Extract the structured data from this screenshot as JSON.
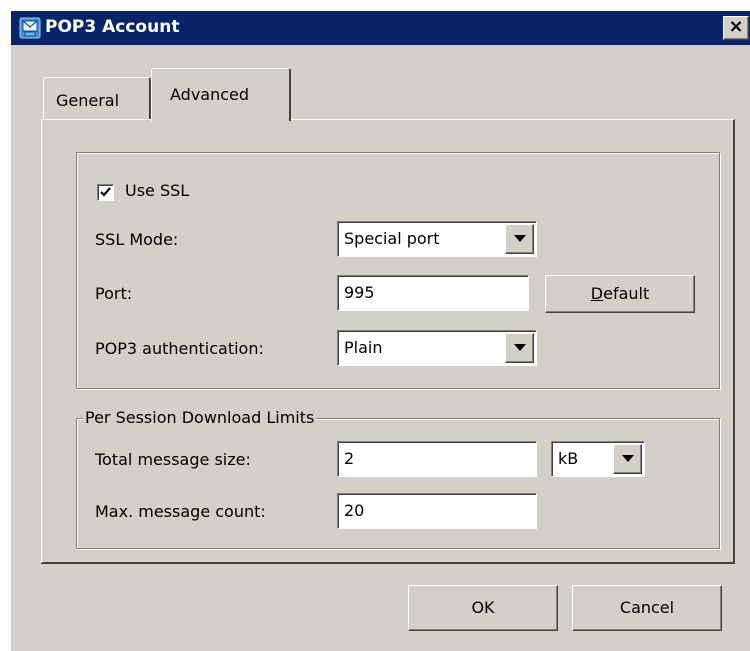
{
  "window": {
    "title": "POP3 Account",
    "close_glyph": "×",
    "icon": "mail-account-icon"
  },
  "tabs": [
    {
      "label": "General",
      "active": false
    },
    {
      "label": "Advanced",
      "active": true
    }
  ],
  "ssl": {
    "use_ssl_label": "Use SSL",
    "use_ssl_checked": true,
    "ssl_mode_label": "SSL Mode:",
    "ssl_mode_value": "Special port",
    "port_label": "Port:",
    "port_value": "995",
    "default_button_prefix": "",
    "default_button_mnemonic": "D",
    "default_button_rest": "efault",
    "auth_label": "POP3 authentication:",
    "auth_value": "Plain"
  },
  "limits": {
    "legend": "Per Session Download Limits",
    "total_size_label": "Total message size:",
    "total_size_value": "2",
    "size_unit": "kB",
    "max_count_label": "Max. message count:",
    "max_count_value": "20"
  },
  "buttons": {
    "ok": "OK",
    "cancel": "Cancel"
  },
  "colors": {
    "titlebar": "#0a246a",
    "face": "#d4d0c8"
  }
}
